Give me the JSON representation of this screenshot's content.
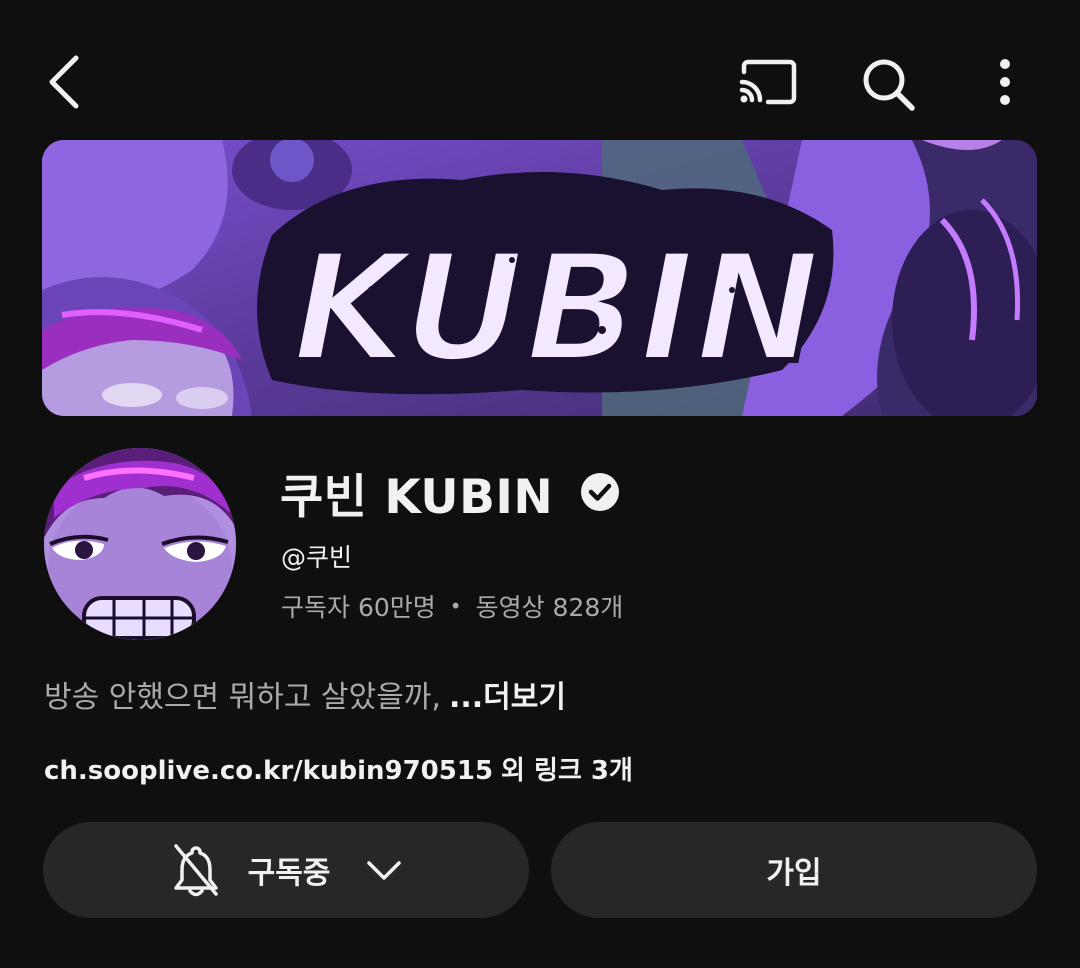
{
  "topbar": {
    "back_icon": "back-arrow-icon",
    "cast_icon": "cast-icon",
    "search_icon": "search-icon",
    "more_icon": "more-vert-icon"
  },
  "banner": {
    "text": "KUBIN"
  },
  "channel": {
    "name": "쿠빈 KUBIN",
    "handle": "@쿠빈",
    "subscribers": "구독자 60만명",
    "separator": "•",
    "videos": "동영상 828개",
    "description": "방송 안했으면 뭐하고 살았을까,",
    "more_label": "...더보기",
    "link_url": "ch.sooplive.co.kr/kubin970515",
    "link_more": "외 링크 3개"
  },
  "buttons": {
    "subscribed_label": "구독중",
    "join_label": "가입"
  },
  "colors": {
    "background": "#0f0f0f",
    "button_bg": "#272727",
    "text_primary": "#f1f1f1",
    "text_secondary": "#aaaaaa",
    "banner_accent": "#8a4fe0"
  }
}
